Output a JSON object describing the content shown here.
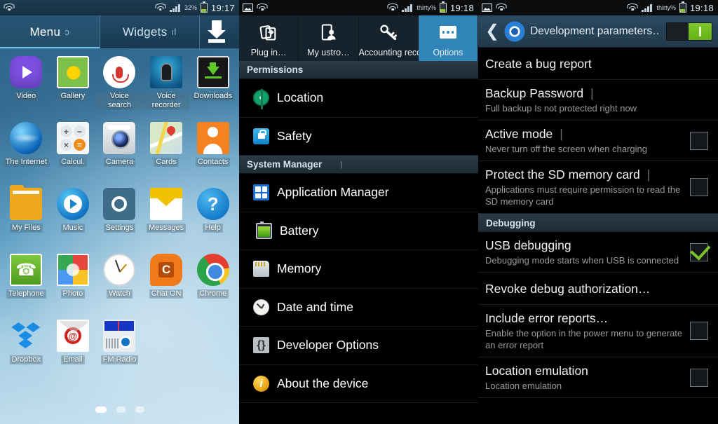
{
  "panel_home": {
    "statusbar": {
      "wifi_icon": "wifi-icon",
      "signal_icon": "signal-icon",
      "battery_percent": "32%",
      "time": "19:17"
    },
    "tabs": [
      {
        "label": "Menu",
        "tail": "ɔ",
        "active": true
      },
      {
        "label": "Widgets",
        "tail": "ıl",
        "active": false
      }
    ],
    "download_icon": "download-icon",
    "apps": [
      {
        "label": "Video",
        "icon": "video-icon"
      },
      {
        "label": "Gallery",
        "icon": "gallery-icon"
      },
      {
        "label": "Voice search",
        "icon": "voice-search-icon"
      },
      {
        "label": "Voice recorder",
        "icon": "voice-recorder-icon"
      },
      {
        "label": "Downloads",
        "icon": "downloads-icon"
      },
      {
        "label": "The Internet",
        "icon": "internet-browser-icon"
      },
      {
        "label": "Calcul.",
        "icon": "calculator-icon"
      },
      {
        "label": "Camera",
        "icon": "camera-icon"
      },
      {
        "label": "Cards",
        "icon": "maps-cards-icon"
      },
      {
        "label": "Contacts",
        "icon": "contacts-icon"
      },
      {
        "label": "My Files",
        "icon": "my-files-icon"
      },
      {
        "label": "Music",
        "icon": "music-icon"
      },
      {
        "label": "Settings",
        "icon": "settings-icon"
      },
      {
        "label": "Messages",
        "icon": "messages-icon"
      },
      {
        "label": "Help",
        "icon": "help-icon"
      },
      {
        "label": "Telephone",
        "icon": "telephone-icon"
      },
      {
        "label": "Photo",
        "icon": "photo-icon"
      },
      {
        "label": "Watch",
        "icon": "watch-icon"
      },
      {
        "label": "Chat ON",
        "icon": "chat-on-icon"
      },
      {
        "label": "Chrome",
        "icon": "chrome-icon"
      },
      {
        "label": "Dropbox",
        "icon": "dropbox-icon"
      },
      {
        "label": "Email",
        "icon": "email-icon"
      },
      {
        "label": "FM Radio",
        "icon": "fm-radio-icon"
      }
    ],
    "page_dots": {
      "count": 3,
      "active_index": 0
    }
  },
  "panel_settings": {
    "statusbar": {
      "image_icon": "image-icon",
      "wifi_icon": "wifi-icon",
      "signal_icon": "signal-icon",
      "battery_percent": "thirty%",
      "time": "19:18"
    },
    "tabs": [
      {
        "label": "Plug in…",
        "icon": "plug-in-icon",
        "active": false
      },
      {
        "label": "My ustro…",
        "icon": "my-device-icon",
        "active": false
      },
      {
        "label": "Accounting records…",
        "icon": "accounting-records-icon",
        "active": false
      },
      {
        "label": "Options",
        "icon": "options-dots-icon",
        "active": true,
        "tail": "ı"
      }
    ],
    "sections": [
      {
        "title": "Permissions",
        "tail": "",
        "rows": [
          {
            "label": "Location",
            "icon": "location-icon"
          },
          {
            "label": "Safety",
            "icon": "safety-lock-icon"
          }
        ]
      },
      {
        "title": "System Manager",
        "tail": "|",
        "rows": [
          {
            "label": "Application Manager",
            "icon": "application-manager-icon"
          },
          {
            "label": "Battery",
            "icon": "battery-icon"
          },
          {
            "label": "Memory",
            "icon": "memory-card-icon"
          },
          {
            "label": "Date and time",
            "icon": "clock-icon"
          },
          {
            "label": "Developer Options",
            "icon": "developer-braces-icon"
          },
          {
            "label": "About the device",
            "icon": "about-info-icon"
          }
        ]
      }
    ]
  },
  "panel_developer": {
    "statusbar": {
      "image_icon": "image-icon",
      "wifi_icon": "wifi-icon",
      "signal_icon": "signal-icon",
      "battery_percent": "thirty%",
      "time": "19:18"
    },
    "header": {
      "back_icon": "back-chevron-icon",
      "gear_icon": "settings-gear-icon",
      "title": "Development parameters…",
      "master_toggle": {
        "name": "master-switch",
        "state": "on"
      }
    },
    "rows": [
      {
        "type": "item",
        "title": "Create a bug report",
        "subtitle": "",
        "control": "none"
      },
      {
        "type": "item",
        "title": "Backup Password",
        "subtitle": "Full backup Is not protected right now",
        "control": "none",
        "bar": "|"
      },
      {
        "type": "item",
        "title": "Active mode",
        "subtitle": "Never turn off the screen when charging",
        "control": "checkbox",
        "checked": false,
        "bar": "|"
      },
      {
        "type": "item",
        "title": "Protect the SD memory card",
        "subtitle": "Applications must require permission to read the SD memory card",
        "control": "checkbox",
        "checked": false,
        "bar": "|"
      },
      {
        "type": "section",
        "title": "Debugging"
      },
      {
        "type": "item",
        "title": "USB debugging",
        "subtitle": "Debugging mode starts when USB is connected",
        "control": "checkbox",
        "checked": true
      },
      {
        "type": "item",
        "title": "Revoke debug authorization…",
        "subtitle": "",
        "control": "none"
      },
      {
        "type": "item",
        "title": "Include error reports…",
        "subtitle": "Enable the option in the power menu to generate an error report",
        "control": "checkbox",
        "checked": false
      },
      {
        "type": "item",
        "title": "Location emulation",
        "subtitle": "Location emulation",
        "control": "checkbox",
        "checked": false
      }
    ]
  },
  "colors": {
    "accent_blue": "#2f85b7",
    "header_blue": "#2c4a60",
    "toggle_green": "#7dc62a",
    "check_green": "#79c428",
    "section_bg": "#2b3a46"
  }
}
